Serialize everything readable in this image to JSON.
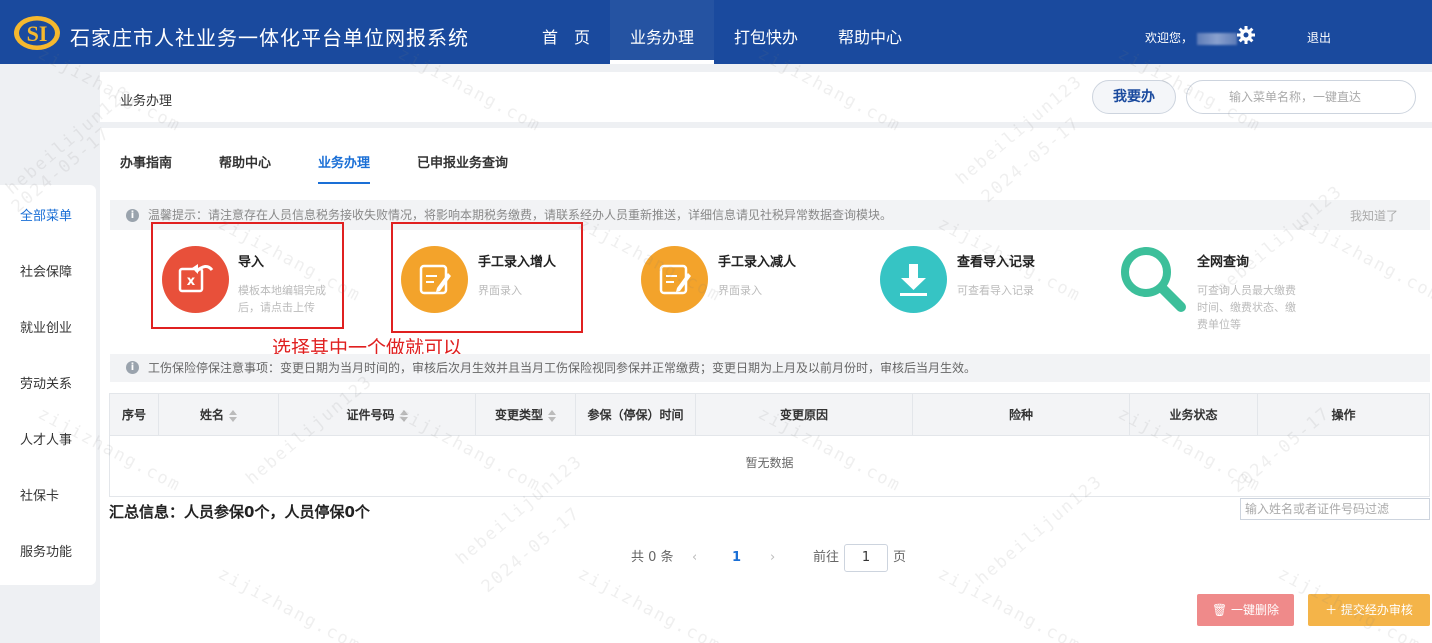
{
  "header": {
    "title": "石家庄市人社业务一体化平台单位网报系统",
    "nav": [
      {
        "label": "首　页",
        "active": false
      },
      {
        "label": "业务办理",
        "active": true
      },
      {
        "label": "打包快办",
        "active": false
      },
      {
        "label": "帮助中心",
        "active": false
      }
    ],
    "welcome": "欢迎您，",
    "logout": "退出"
  },
  "breadcrumb": "业务办理",
  "quick": {
    "want_label": "我要办",
    "search_placeholder": "输入菜单名称，一键直达"
  },
  "sidebar": {
    "items": [
      "全部菜单",
      "社会保障",
      "就业创业",
      "劳动关系",
      "人才人事",
      "社保卡",
      "服务功能"
    ]
  },
  "tabs": [
    {
      "label": "办事指南",
      "active": false
    },
    {
      "label": "帮助中心",
      "active": false
    },
    {
      "label": "业务办理",
      "active": true
    },
    {
      "label": "已申报业务查询",
      "active": false
    }
  ],
  "notice1": {
    "text": "温馨提示：请注意存在人员信息税务接收失败情况，将影响本期税务缴费，请联系经办人员重新推送，详细信息请见社税异常数据查询模块。",
    "dismiss": "我知道了"
  },
  "actions": [
    {
      "title": "导入",
      "desc": "模板本地编辑完成后，请点击上传",
      "icon": "excel-import-icon",
      "color": "#e8503a"
    },
    {
      "title": "手工录入增人",
      "desc": "界面录入",
      "icon": "edit-form-icon",
      "color": "#f3a32b"
    },
    {
      "title": "手工录入减人",
      "desc": "界面录入",
      "icon": "edit-form-icon",
      "color": "#f3a32b"
    },
    {
      "title": "查看导入记录",
      "desc": "可查看导入记录",
      "icon": "download-icon",
      "color": "#36c4c4"
    },
    {
      "title": "全网查询",
      "desc": "可查询人员最大缴费时间、缴费状态、缴费单位等",
      "icon": "search-icon",
      "color": "#3cbf9a"
    }
  ],
  "annotation": "选择其中一个做就可以",
  "notice2": "工伤保险停保注意事项：变更日期为当月时间的，审核后次月生效并且当月工伤保险视同参保并正常缴费；变更日期为上月及以前月份时，审核后当月生效。",
  "table": {
    "columns": [
      "序号",
      "姓名",
      "证件号码",
      "变更类型",
      "参保（停保）时间",
      "变更原因",
      "险种",
      "业务状态",
      "操作"
    ],
    "empty_text": "暂无数据"
  },
  "summary": "汇总信息：人员参保0个，人员停保0个",
  "filter_placeholder": "输入姓名或者证件号码过滤",
  "pagination": {
    "total": "共 0 条",
    "current_page": "1",
    "goto_label": "前往",
    "goto_value": "1",
    "page_unit": "页"
  },
  "buttons": {
    "delete": "一键删除",
    "submit": "提交经办审核"
  },
  "watermark": {
    "site": "zijizhang.com",
    "user": "hebeilijun123",
    "date": "2024-05-17"
  },
  "colors": {
    "header_bg": "#1a4a9e",
    "accent": "#1a6fd6",
    "annotation_red": "#e02020"
  }
}
